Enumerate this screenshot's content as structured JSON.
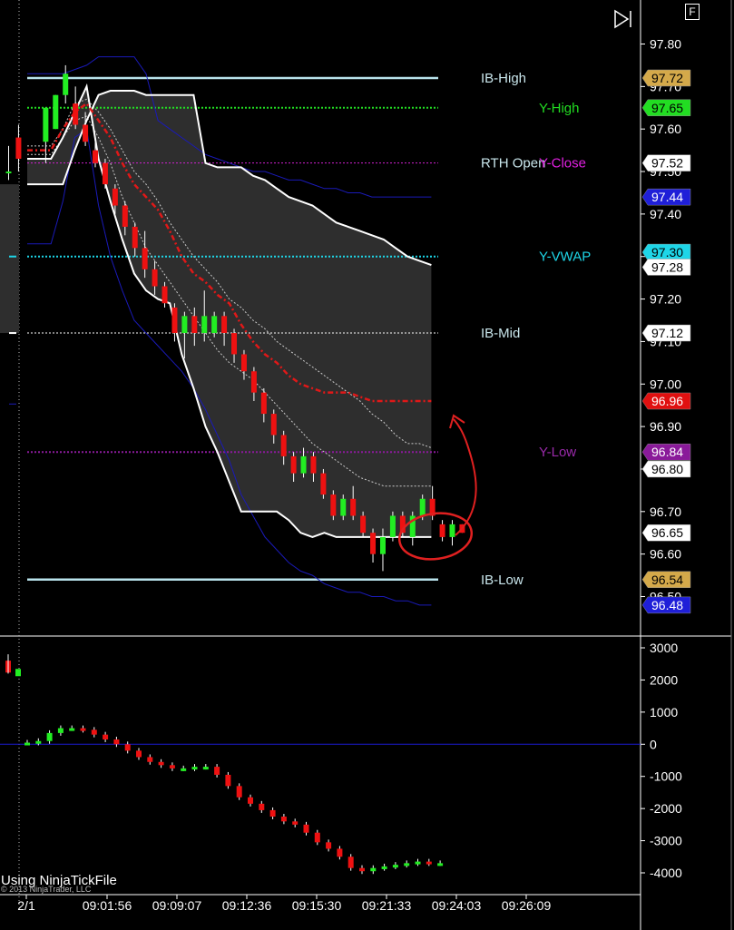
{
  "window": {
    "frame_button_label": "F",
    "play_icon": "skip-forward-icon"
  },
  "chart_data": [
    {
      "type": "candlestick",
      "panel": "price",
      "y_ticks": [
        97.8,
        97.7,
        97.6,
        97.5,
        97.4,
        97.3,
        97.2,
        97.1,
        97.0,
        96.9,
        96.8,
        96.7,
        96.6,
        96.5
      ],
      "ylim": [
        96.45,
        97.86
      ],
      "x_tick_labels": [
        "2/1",
        "09:01:56",
        "09:09:07",
        "09:12:36",
        "09:15:30",
        "09:21:33",
        "09:24:03",
        "09:26:09"
      ],
      "levels": [
        {
          "label": "IB-High",
          "value": 97.72,
          "color": "#b9e3ec",
          "style": "solid",
          "label_color": "#c9e6ec"
        },
        {
          "label": "Y-High",
          "value": 97.65,
          "color": "#22dd22",
          "style": "dotted",
          "label_color": "#22dd22"
        },
        {
          "label": "RTH Open",
          "value": 97.52,
          "color": "#d020d0",
          "style": "dotted",
          "label_color": "#c9e6ec"
        },
        {
          "label": "Y-Close",
          "value": 97.52,
          "color": "#d020d0",
          "style": "none",
          "label_color": "#e020e0"
        },
        {
          "label": "Y-VWAP",
          "value": 97.3,
          "color": "#1ed6e8",
          "style": "dotted",
          "label_color": "#1ed6e8"
        },
        {
          "label": "IB-Mid",
          "value": 97.12,
          "color": "#ffffff",
          "style": "dotted",
          "label_color": "#c9e6ec"
        },
        {
          "label": "Y-Low",
          "value": 96.84,
          "color": "#8a1a9a",
          "style": "dotted",
          "label_color": "#9a2aaa"
        },
        {
          "label": "IB-Low",
          "value": 96.54,
          "color": "#b9e3ec",
          "style": "solid",
          "label_color": "#c9e6ec"
        }
      ],
      "price_badges": [
        {
          "text": "97.72",
          "value": 97.72,
          "bg": "#d4a94a",
          "fg": "#000000"
        },
        {
          "text": "97.65",
          "value": 97.65,
          "bg": "#22dd22",
          "fg": "#000000"
        },
        {
          "text": "97.52",
          "value": 97.52,
          "bg": "#ffffff",
          "fg": "#000000"
        },
        {
          "text": "97.44",
          "value": 97.44,
          "bg": "#1f1fd8",
          "fg": "#ffffff"
        },
        {
          "text": "97.30",
          "value": 97.31,
          "bg": "#1ed6e8",
          "fg": "#000000"
        },
        {
          "text": "97.28",
          "value": 97.275,
          "bg": "#ffffff",
          "fg": "#000000"
        },
        {
          "text": "97.12",
          "value": 97.12,
          "bg": "#ffffff",
          "fg": "#000000"
        },
        {
          "text": "96.96",
          "value": 96.96,
          "bg": "#e01010",
          "fg": "#ffffff"
        },
        {
          "text": "96.84",
          "value": 96.84,
          "bg": "#8a1a9a",
          "fg": "#ffffff"
        },
        {
          "text": "96.80",
          "value": 96.8,
          "bg": "#ffffff",
          "fg": "#000000"
        },
        {
          "text": "96.65",
          "value": 96.65,
          "bg": "#ffffff",
          "fg": "#000000"
        },
        {
          "text": "96.54",
          "value": 96.54,
          "bg": "#d4a94a",
          "fg": "#000000"
        },
        {
          "text": "96.48",
          "value": 96.48,
          "bg": "#1f1fd8",
          "fg": "#ffffff"
        }
      ],
      "candles": [
        {
          "o": 97.5,
          "h": 97.56,
          "l": 97.48,
          "c": 97.5
        },
        {
          "o": 97.58,
          "h": 97.61,
          "l": 97.5,
          "c": 97.53
        },
        {
          "o": 97.57,
          "h": 97.65,
          "l": 97.52,
          "c": 97.65
        },
        {
          "o": 97.6,
          "h": 97.68,
          "l": 97.6,
          "c": 97.68
        },
        {
          "o": 97.68,
          "h": 97.75,
          "l": 97.66,
          "c": 97.73
        },
        {
          "o": 97.66,
          "h": 97.7,
          "l": 97.6,
          "c": 97.61
        },
        {
          "o": 97.61,
          "h": 97.64,
          "l": 97.56,
          "c": 97.57
        },
        {
          "o": 97.55,
          "h": 97.57,
          "l": 97.51,
          "c": 97.52
        },
        {
          "o": 97.52,
          "h": 97.53,
          "l": 97.46,
          "c": 97.47
        },
        {
          "o": 97.46,
          "h": 97.47,
          "l": 97.4,
          "c": 97.42
        },
        {
          "o": 97.42,
          "h": 97.43,
          "l": 97.35,
          "c": 97.37
        },
        {
          "o": 97.37,
          "h": 97.38,
          "l": 97.3,
          "c": 97.32
        },
        {
          "o": 97.32,
          "h": 97.36,
          "l": 97.25,
          "c": 97.27
        },
        {
          "o": 97.27,
          "h": 97.29,
          "l": 97.21,
          "c": 97.23
        },
        {
          "o": 97.23,
          "h": 97.24,
          "l": 97.18,
          "c": 97.19
        },
        {
          "o": 97.18,
          "h": 97.19,
          "l": 97.1,
          "c": 97.12
        },
        {
          "o": 97.12,
          "h": 97.17,
          "l": 97.06,
          "c": 97.16
        },
        {
          "o": 97.16,
          "h": 97.18,
          "l": 97.09,
          "c": 97.12
        },
        {
          "o": 97.12,
          "h": 97.22,
          "l": 97.1,
          "c": 97.16
        },
        {
          "o": 97.12,
          "h": 97.17,
          "l": 97.11,
          "c": 97.16
        },
        {
          "o": 97.16,
          "h": 97.17,
          "l": 97.09,
          "c": 97.12
        },
        {
          "o": 97.12,
          "h": 97.13,
          "l": 97.05,
          "c": 97.07
        },
        {
          "o": 97.07,
          "h": 97.08,
          "l": 97.01,
          "c": 97.03
        },
        {
          "o": 97.03,
          "h": 97.04,
          "l": 96.96,
          "c": 96.98
        },
        {
          "o": 96.98,
          "h": 96.99,
          "l": 96.91,
          "c": 96.93
        },
        {
          "o": 96.93,
          "h": 96.94,
          "l": 96.86,
          "c": 96.88
        },
        {
          "o": 96.88,
          "h": 96.89,
          "l": 96.81,
          "c": 96.83
        },
        {
          "o": 96.83,
          "h": 96.84,
          "l": 96.77,
          "c": 96.79
        },
        {
          "o": 96.79,
          "h": 96.85,
          "l": 96.78,
          "c": 96.83
        },
        {
          "o": 96.83,
          "h": 96.84,
          "l": 96.77,
          "c": 96.79
        },
        {
          "o": 96.79,
          "h": 96.8,
          "l": 96.73,
          "c": 96.74
        },
        {
          "o": 96.74,
          "h": 96.75,
          "l": 96.68,
          "c": 96.69
        },
        {
          "o": 96.69,
          "h": 96.74,
          "l": 96.68,
          "c": 96.73
        },
        {
          "o": 96.73,
          "h": 96.76,
          "l": 96.68,
          "c": 96.69
        },
        {
          "o": 96.69,
          "h": 96.7,
          "l": 96.64,
          "c": 96.65
        },
        {
          "o": 96.65,
          "h": 96.66,
          "l": 96.58,
          "c": 96.6
        },
        {
          "o": 96.6,
          "h": 96.66,
          "l": 96.56,
          "c": 96.64
        },
        {
          "o": 96.64,
          "h": 96.7,
          "l": 96.63,
          "c": 96.69
        },
        {
          "o": 96.69,
          "h": 96.7,
          "l": 96.64,
          "c": 96.65
        },
        {
          "o": 96.64,
          "h": 96.7,
          "l": 96.62,
          "c": 96.69
        },
        {
          "o": 96.69,
          "h": 96.74,
          "l": 96.68,
          "c": 96.73
        },
        {
          "o": 96.73,
          "h": 96.76,
          "l": 96.68,
          "c": 96.69
        },
        {
          "o": 96.67,
          "h": 96.68,
          "l": 96.63,
          "c": 96.64
        },
        {
          "o": 96.64,
          "h": 96.68,
          "l": 96.62,
          "c": 96.67
        },
        {
          "o": 96.67,
          "h": 96.67,
          "l": 96.65,
          "c": 96.65
        }
      ],
      "bands": {
        "upper_outer": [
          97.47,
          97.47,
          97.47,
          97.47,
          97.55,
          97.62,
          97.68,
          97.69,
          97.69,
          97.69,
          97.68,
          97.68,
          97.68,
          97.68,
          97.68,
          97.52,
          97.51,
          97.51,
          97.51,
          97.49,
          97.48,
          97.46,
          97.44,
          97.43,
          97.42,
          97.4,
          97.38,
          97.37,
          97.36,
          97.35,
          97.34,
          97.32,
          97.3,
          97.29,
          97.28
        ],
        "lower_outer": [
          97.53,
          97.53,
          97.53,
          97.58,
          97.64,
          97.7,
          97.53,
          97.43,
          97.34,
          97.26,
          97.22,
          97.2,
          97.19,
          97.07,
          96.99,
          96.9,
          96.84,
          96.77,
          96.7,
          96.7,
          96.7,
          96.7,
          96.68,
          96.65,
          96.64,
          96.65,
          96.64,
          96.64,
          96.64,
          96.64,
          96.64,
          96.64,
          96.64,
          96.64,
          96.64
        ],
        "mid_dashed": [
          97.55,
          97.55,
          97.55,
          97.6,
          97.64,
          97.66,
          97.62,
          97.58,
          97.52,
          97.47,
          97.44,
          97.41,
          97.36,
          97.3,
          97.26,
          97.24,
          97.21,
          97.19,
          97.14,
          97.1,
          97.07,
          97.05,
          97.02,
          97.0,
          96.99,
          96.98,
          96.98,
          96.98,
          96.97,
          96.96,
          96.96,
          96.96,
          96.96,
          96.96,
          96.96
        ],
        "inner_upper": [
          97.56,
          97.56,
          97.56,
          97.6,
          97.66,
          97.67,
          97.64,
          97.6,
          97.55,
          97.5,
          97.47,
          97.43,
          97.38,
          97.34,
          97.3,
          97.27,
          97.24,
          97.2,
          97.18,
          97.15,
          97.13,
          97.1,
          97.08,
          97.06,
          97.04,
          97.02,
          97.0,
          96.98,
          96.96,
          96.93,
          96.91,
          96.88,
          96.86,
          96.86,
          96.85
        ],
        "inner_lower": [
          97.54,
          97.54,
          97.54,
          97.58,
          97.62,
          97.63,
          97.58,
          97.52,
          97.44,
          97.38,
          97.32,
          97.28,
          97.24,
          97.2,
          97.16,
          97.12,
          97.08,
          97.05,
          97.03,
          97.01,
          96.98,
          96.95,
          96.92,
          96.89,
          96.86,
          96.84,
          96.82,
          96.8,
          96.78,
          96.77,
          96.76,
          96.76,
          96.76,
          96.76,
          96.76
        ],
        "blue_upper": [
          97.73,
          97.73,
          97.73,
          97.73,
          97.74,
          97.75,
          97.77,
          97.77,
          97.77,
          97.77,
          97.73,
          97.62,
          97.6,
          97.58,
          97.56,
          97.54,
          97.53,
          97.52,
          97.51,
          97.5,
          97.5,
          97.49,
          97.48,
          97.48,
          97.47,
          97.46,
          97.46,
          97.45,
          97.45,
          97.44,
          97.44,
          97.44,
          97.44,
          97.44,
          97.44
        ],
        "blue_lower": [
          97.33,
          97.33,
          97.33,
          97.43,
          97.58,
          97.6,
          97.42,
          97.3,
          97.22,
          97.15,
          97.12,
          97.09,
          97.06,
          97.03,
          96.99,
          96.94,
          96.88,
          96.82,
          96.74,
          96.69,
          96.64,
          96.61,
          96.58,
          96.56,
          96.55,
          96.53,
          96.52,
          96.51,
          96.51,
          96.5,
          96.5,
          96.49,
          96.49,
          96.48,
          96.48
        ]
      }
    },
    {
      "type": "candlestick",
      "panel": "indicator",
      "y_ticks": [
        3000,
        2000,
        1000,
        0,
        -1000,
        -2000,
        -3000,
        -4000
      ],
      "ylim": [
        -4300,
        3200
      ],
      "zero_line": 0,
      "first_bar": {
        "o": 2600,
        "h": 2800,
        "l": 2200,
        "c": 2400
      },
      "values": [
        50,
        100,
        350,
        500,
        500,
        450,
        300,
        150,
        0,
        -200,
        -400,
        -550,
        -650,
        -750,
        -750,
        -700,
        -700,
        -950,
        -1300,
        -1650,
        -1850,
        -2050,
        -2250,
        -2400,
        -2500,
        -2750,
        -3050,
        -3250,
        -3500,
        -3850,
        -3950,
        -3850,
        -3800,
        -3750,
        -3700,
        -3650,
        -3700,
        -3700
      ]
    }
  ],
  "watermark_text": "Using NinjaTickFile",
  "copyright_text": "© 2013 NinjaTrader, LLC",
  "annotation": {
    "color": "#e02020"
  }
}
